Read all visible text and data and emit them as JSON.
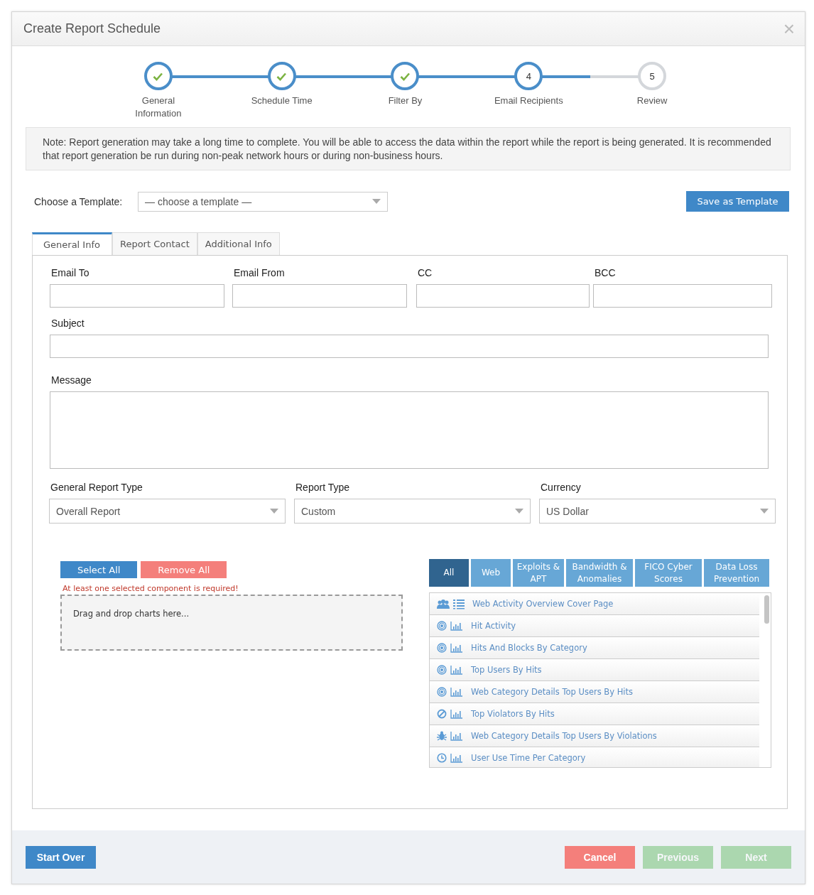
{
  "window": {
    "title": "Create Report Schedule",
    "close": "×"
  },
  "steps": [
    {
      "label": "General Information",
      "completed": true,
      "current": false
    },
    {
      "label": "Schedule Time",
      "completed": true,
      "current": false
    },
    {
      "label": "Filter By",
      "completed": true,
      "current": false
    },
    {
      "label": "Email Recipients",
      "completed": false,
      "current": true,
      "number": "4"
    },
    {
      "label": "Review",
      "completed": false,
      "current": false,
      "number": "5"
    }
  ],
  "note": "Note: Report generation may take a long time to complete. You will be able to access the data within the report while the report is being generated. It is recommended that report generation be run during non-peak network hours or during non-business hours.",
  "template": {
    "label": "Choose a Template:",
    "value": "— choose a template —",
    "save_button": "Save as Template"
  },
  "tabs": [
    {
      "label": "General Info",
      "selected": true
    },
    {
      "label": "Report Contact",
      "selected": false
    },
    {
      "label": "Additional Info",
      "selected": false
    }
  ],
  "email_fields": [
    {
      "label": "Email To"
    },
    {
      "label": "Email From"
    },
    {
      "label": "CC"
    },
    {
      "label": "BCC"
    }
  ],
  "subject": {
    "label": "Subject"
  },
  "message": {
    "label": "Message"
  },
  "selects": [
    {
      "label": "General Report Type",
      "value": "Overall Report"
    },
    {
      "label": "Report Type",
      "value": "Custom"
    },
    {
      "label": "Currency",
      "value": "US Dollar"
    }
  ],
  "components": {
    "select_all": "Select All",
    "remove_all": "Remove All",
    "error": "At least one selected component is required!",
    "drop_hint": "Drag and drop charts here..."
  },
  "categories": [
    {
      "label": "All",
      "selected": true
    },
    {
      "label": "Web",
      "selected": false
    },
    {
      "label": "Exploits & APT",
      "selected": false
    },
    {
      "label": "Bandwidth & Anomalies",
      "selected": false
    },
    {
      "label": "FICO Cyber Scores",
      "selected": false
    },
    {
      "label": "Data Loss Prevention",
      "selected": false
    }
  ],
  "charts": [
    {
      "label": "Web Activity Overview Cover Page",
      "kind": "users"
    },
    {
      "label": "Hit Activity",
      "kind": "target"
    },
    {
      "label": "Hits And Blocks By Category",
      "kind": "target"
    },
    {
      "label": "Top Users By Hits",
      "kind": "target"
    },
    {
      "label": "Web Category Details Top Users By Hits",
      "kind": "target"
    },
    {
      "label": "Top Violators By Hits",
      "kind": "blocked"
    },
    {
      "label": "Web Category Details Top Users By Violations",
      "kind": "bug"
    },
    {
      "label": "User Use Time Per Category",
      "kind": "clock"
    }
  ],
  "footer": [
    {
      "label": "Start Over",
      "kind": "primary",
      "disabled": false
    },
    {
      "label": "Cancel",
      "kind": "danger",
      "disabled": false
    },
    {
      "label": "Previous",
      "kind": "success",
      "disabled": true
    },
    {
      "label": "Next",
      "kind": "success",
      "disabled": true
    }
  ]
}
